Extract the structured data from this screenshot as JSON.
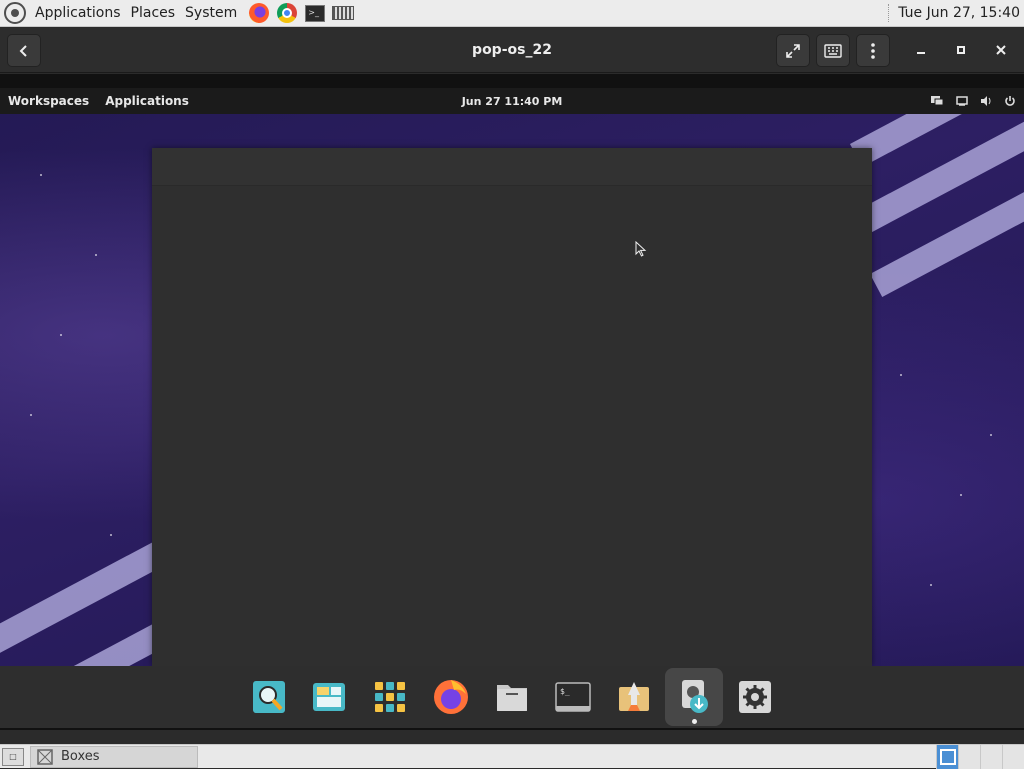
{
  "host_panel": {
    "menus": [
      "Applications",
      "Places",
      "System"
    ],
    "launchers": [
      "firefox-icon",
      "chrome-icon",
      "terminal-icon",
      "vm-icon"
    ],
    "clock": "Tue Jun 27, 15:40"
  },
  "boxes_window": {
    "title": "pop-os_22",
    "back_icon": "chevron-left-icon",
    "buttons": [
      "fullscreen-icon",
      "keyboard-icon",
      "more-icon"
    ],
    "window_controls": [
      "minimize-icon",
      "maximize-icon",
      "close-icon"
    ]
  },
  "guest": {
    "topbar": {
      "workspaces": "Workspaces",
      "applications": "Applications",
      "clock": "Jun 27  11:40 PM",
      "tray_icons": [
        "display-icon",
        "network-icon",
        "volume-icon",
        "power-icon"
      ]
    },
    "dock": {
      "items": [
        "search-icon",
        "workspaces-icon",
        "app-grid-icon",
        "firefox-icon",
        "files-icon",
        "terminal-icon",
        "installer-icon",
        "disk-installer-icon",
        "settings-icon"
      ],
      "active_index": 7
    }
  },
  "host_taskbar": {
    "task_label": "Boxes"
  },
  "colors": {
    "accent": "#4a8fd4",
    "wallpaper": "#2d1f63",
    "window_bg": "#2f2f2f"
  }
}
